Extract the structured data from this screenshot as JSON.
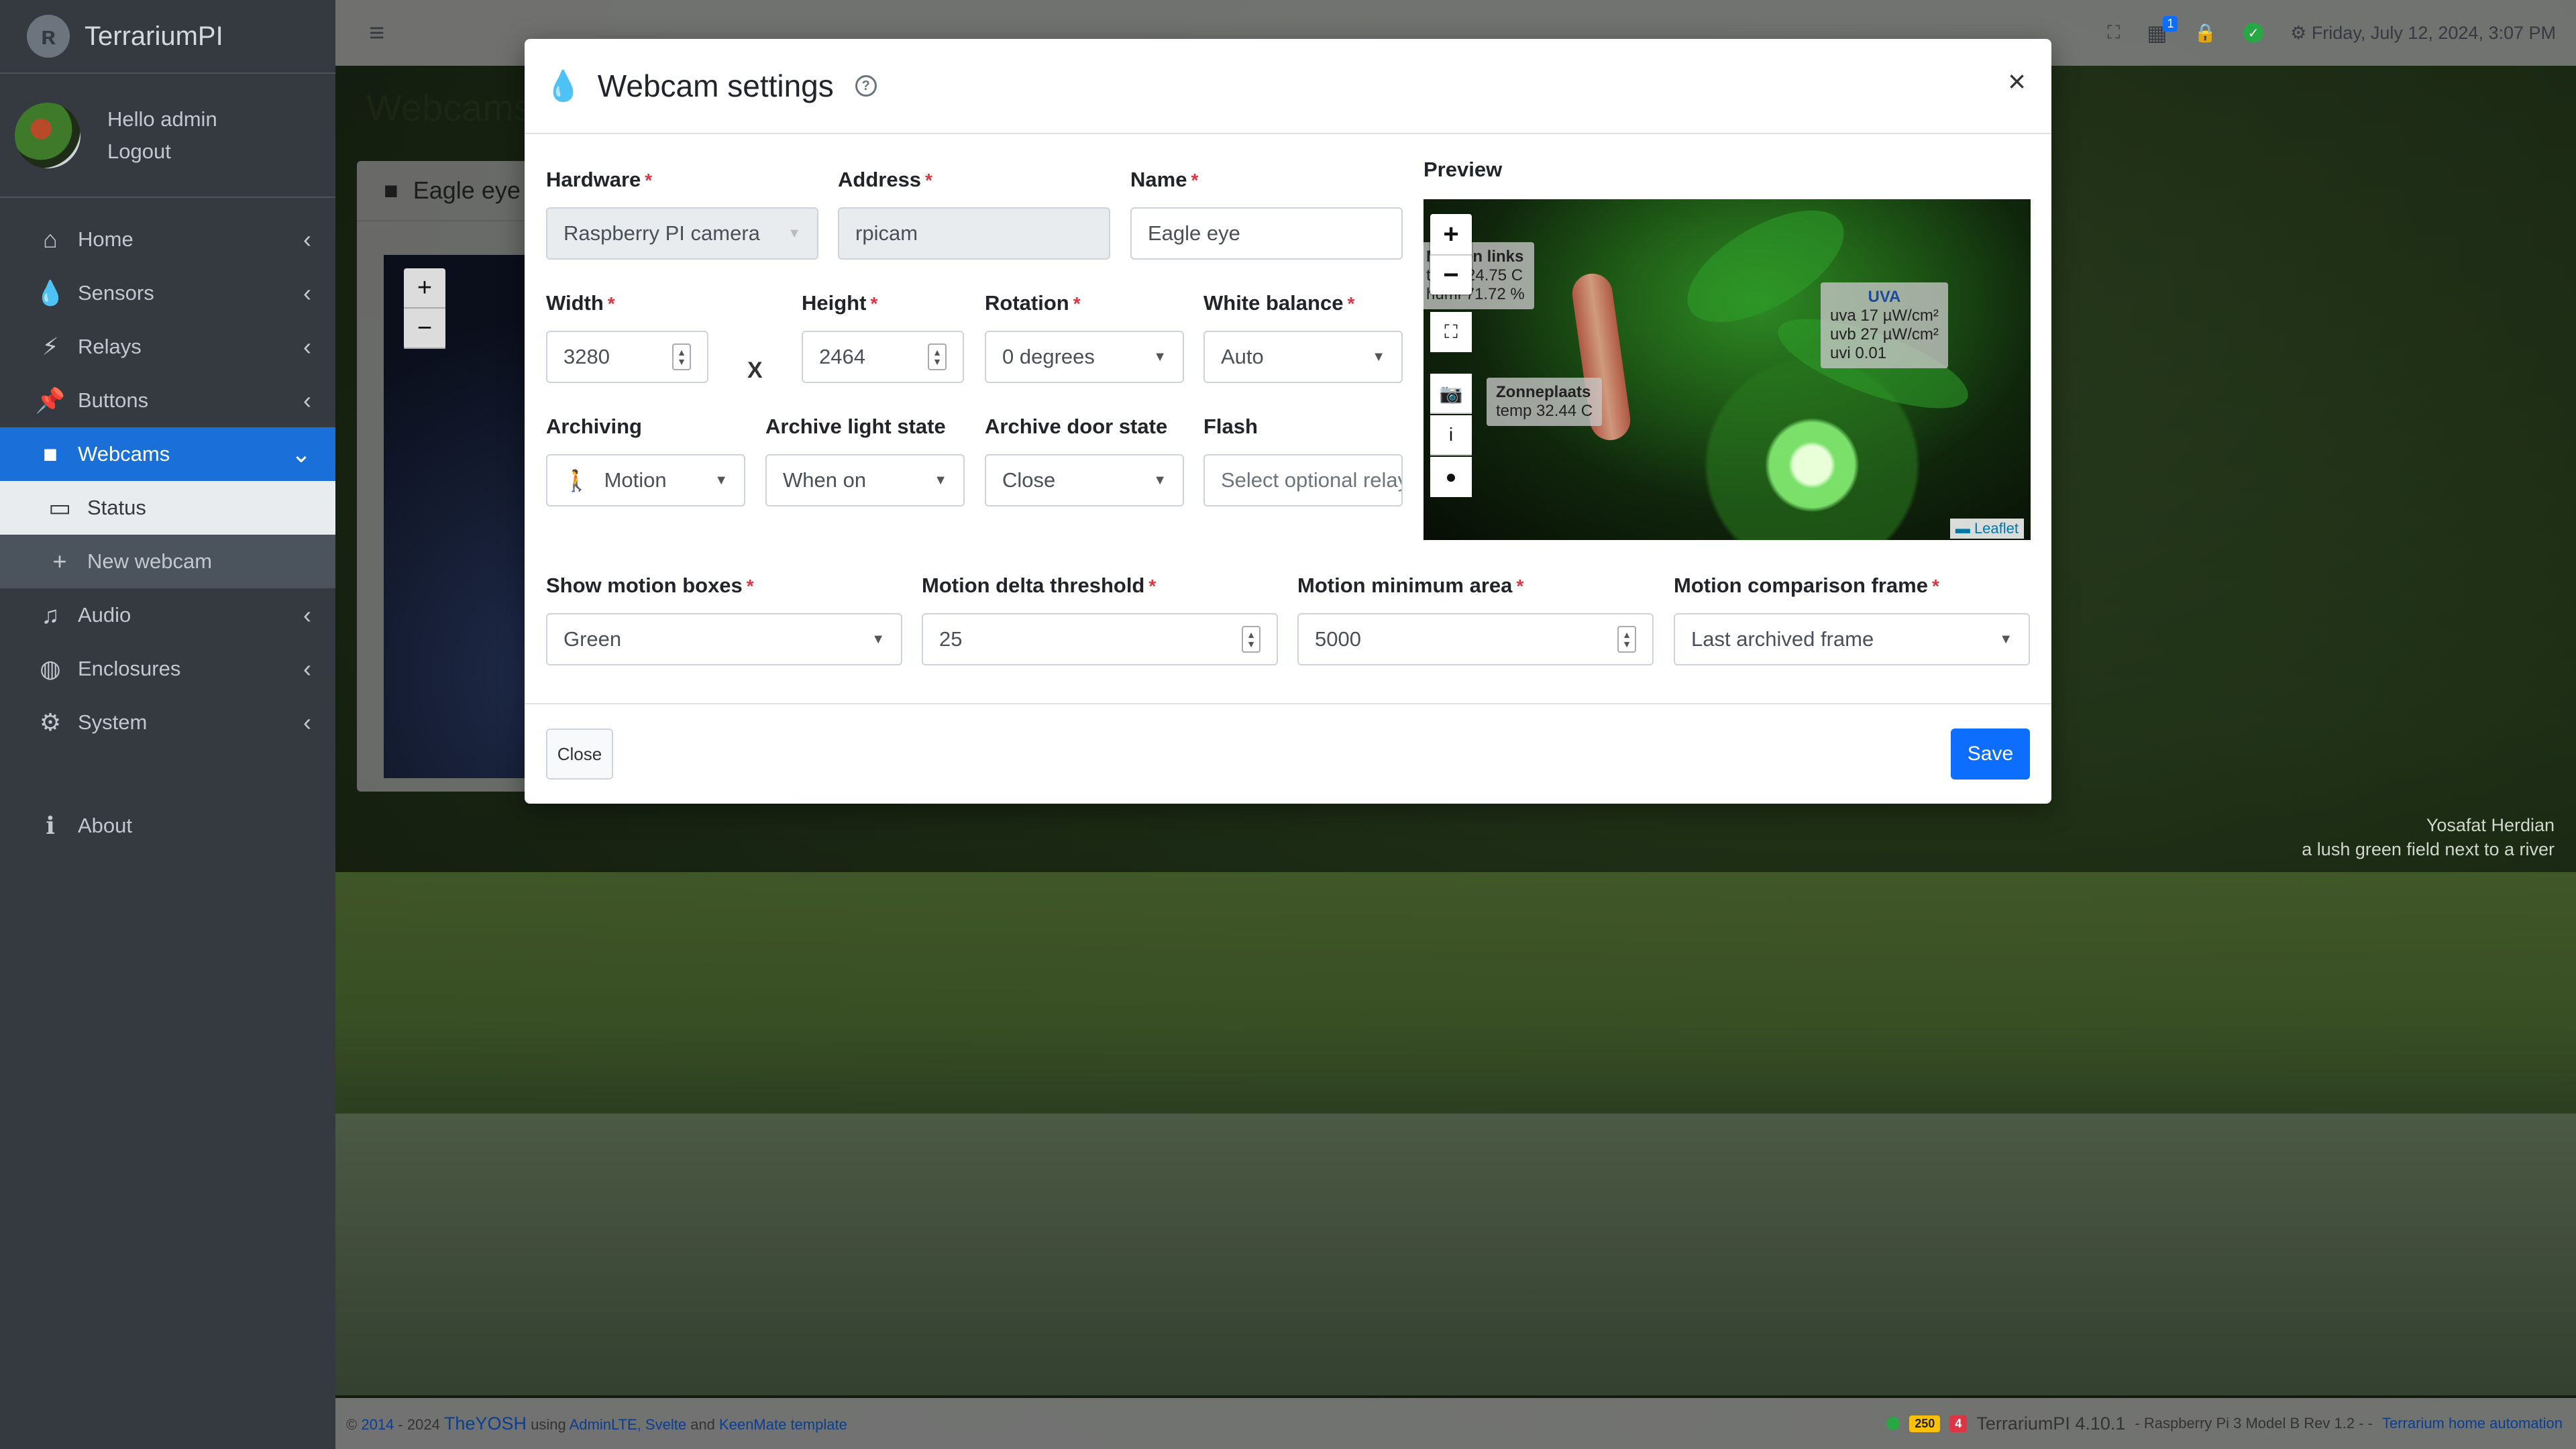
{
  "app": {
    "brand": "TerrariumPI",
    "user_greeting": "Hello admin",
    "logout_label": "Logout"
  },
  "sidebar": {
    "items": [
      {
        "label": "Home",
        "icon": "home-icon"
      },
      {
        "label": "Sensors",
        "icon": "drop-icon"
      },
      {
        "label": "Relays",
        "icon": "bolt-icon"
      },
      {
        "label": "Buttons",
        "icon": "pushpin-icon"
      },
      {
        "label": "Webcams",
        "icon": "video-icon"
      },
      {
        "label": "Audio",
        "icon": "music-icon"
      },
      {
        "label": "Enclosures",
        "icon": "globe-icon"
      },
      {
        "label": "System",
        "icon": "gear-icon"
      },
      {
        "label": "About",
        "icon": "info-icon"
      }
    ],
    "webcam_sub": [
      {
        "label": "Status",
        "icon": "monitor-icon"
      },
      {
        "label": "New webcam",
        "icon": "plus-icon"
      }
    ]
  },
  "topbar": {
    "datetime": "Friday, July 12, 2024, 3:07 PM",
    "calendar_badge": "1"
  },
  "background": {
    "page_title": "Webcams",
    "card_title": "Eagle eye"
  },
  "modal": {
    "title": "Webcam settings",
    "fields": {
      "hardware": {
        "label": "Hardware",
        "value": "Raspberry PI camera"
      },
      "address": {
        "label": "Address",
        "value": "rpicam"
      },
      "name": {
        "label": "Name",
        "value": "Eagle eye"
      },
      "width": {
        "label": "Width",
        "value": "3280"
      },
      "height": {
        "label": "Height",
        "value": "2464"
      },
      "rotation": {
        "label": "Rotation",
        "value": "0 degrees"
      },
      "white_balance": {
        "label": "White balance",
        "value": "Auto"
      },
      "archiving": {
        "label": "Archiving",
        "value": "Motion"
      },
      "archive_light": {
        "label": "Archive light state",
        "value": "When on"
      },
      "archive_door": {
        "label": "Archive door state",
        "value": "Close"
      },
      "flash": {
        "label": "Flash",
        "placeholder": "Select optional relay"
      },
      "show_motion_boxes": {
        "label": "Show motion boxes",
        "value": "Green"
      },
      "motion_delta": {
        "label": "Motion delta threshold",
        "value": "25"
      },
      "motion_min_area": {
        "label": "Motion minimum area",
        "value": "5000"
      },
      "motion_compare": {
        "label": "Motion comparison frame",
        "value": "Last archived frame"
      }
    },
    "x_separator": "X",
    "preview": {
      "label": "Preview",
      "tooltip_left": {
        "title": "Midden links",
        "line1": "temp 24.75 C",
        "line2": "humi 71.72 %"
      },
      "tooltip_zon": {
        "title": "Zonneplaats",
        "line1": "temp 32.44 C"
      },
      "tooltip_uva": {
        "title": "UVA",
        "line1": "uva 17 µW/cm²",
        "line2": "uvb 27 µW/cm²",
        "line3": "uvi 0.01"
      },
      "attribution": "Leaflet"
    },
    "close_label": "Close",
    "save_label": "Save"
  },
  "photo_credit": {
    "author": "Yosafat Herdian",
    "caption": "a lush green field next to a river"
  },
  "footer": {
    "copyright_prefix": "©",
    "year_start": "2014",
    "year_rest": "- 2024",
    "author": "TheYOSH",
    "using": "using",
    "lib1": "AdminLTE,",
    "lib2": "Svelte",
    "and": "and",
    "lib3": "KeenMate template",
    "badge1": "250",
    "badge2": "4",
    "version": "TerrariumPI 4.10.1",
    "device": "- Raspberry Pi 3 Model B Rev 1.2 - -",
    "tagline": "Terrarium home automation"
  }
}
